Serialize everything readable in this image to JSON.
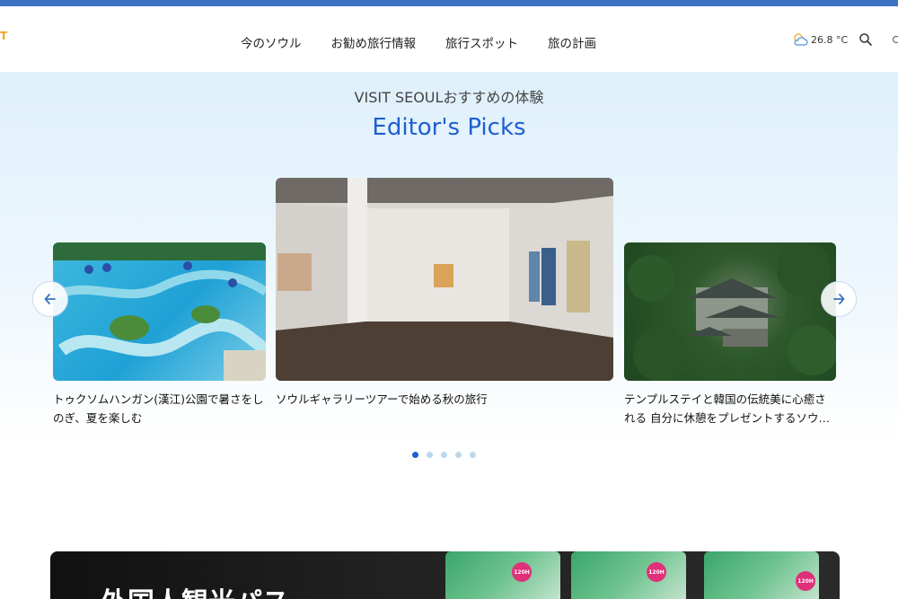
{
  "header": {
    "logo_fragment": "T",
    "nav": [
      {
        "label": "今のソウル"
      },
      {
        "label": "お勧め旅行情報"
      },
      {
        "label": "旅行スポット"
      },
      {
        "label": "旅の計画"
      }
    ],
    "weather": {
      "temperature": "26.8 °C",
      "icon": "partly-cloudy-icon"
    }
  },
  "hero": {
    "subtitle": "VISIT SEOULおすすめの体験",
    "title": "Editor's Picks",
    "cards": [
      {
        "caption": "トゥクソムハンガン(漢江)公園で暑さをしのぎ、夏を楽しむ",
        "image": "water-park-photo"
      },
      {
        "caption": "ソウルギャラリーツアーで始める秋の旅行",
        "image": "gallery-photo"
      },
      {
        "caption": "テンプルステイと韓国の伝統美に心癒される 自分に休憩をプレゼントするソウ…",
        "image": "temple-photo"
      }
    ],
    "pagination": {
      "total": 5,
      "active_index": 0
    }
  },
  "banner": {
    "title": "外国人観光パス",
    "pass_badge": "120H"
  },
  "colors": {
    "accent": "#1e5fcf",
    "topbar": "#3b72c4",
    "hero_bg": "#dff0fb",
    "badge": "#e0307a"
  }
}
